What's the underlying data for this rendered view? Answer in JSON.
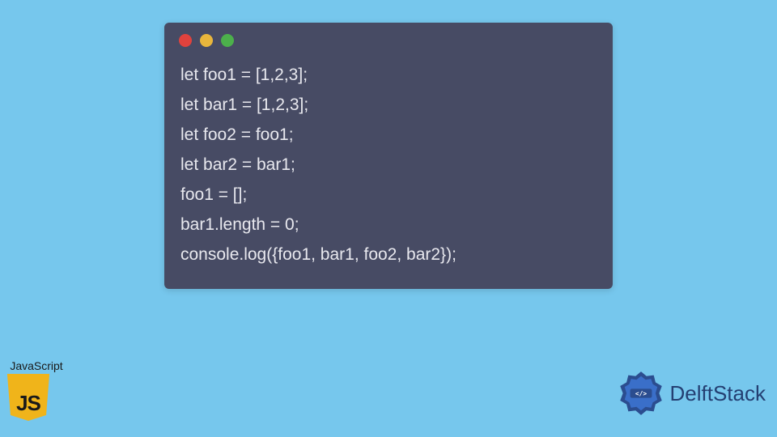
{
  "code": {
    "lines": [
      "let foo1 = [1,2,3];",
      "let bar1 = [1,2,3];",
      "let foo2 = foo1;",
      "let bar2 = bar1;",
      "foo1 = [];",
      "bar1.length = 0;",
      "console.log({foo1, bar1, foo2, bar2});"
    ]
  },
  "js_badge": {
    "label": "JavaScript",
    "icon_text": "JS"
  },
  "delft": {
    "text": "DelftStack"
  },
  "colors": {
    "background": "#76c7ed",
    "window": "#474b64",
    "code_text": "#e8e8ee",
    "js_yellow": "#f0b41a",
    "delft_blue": "#243f72"
  }
}
